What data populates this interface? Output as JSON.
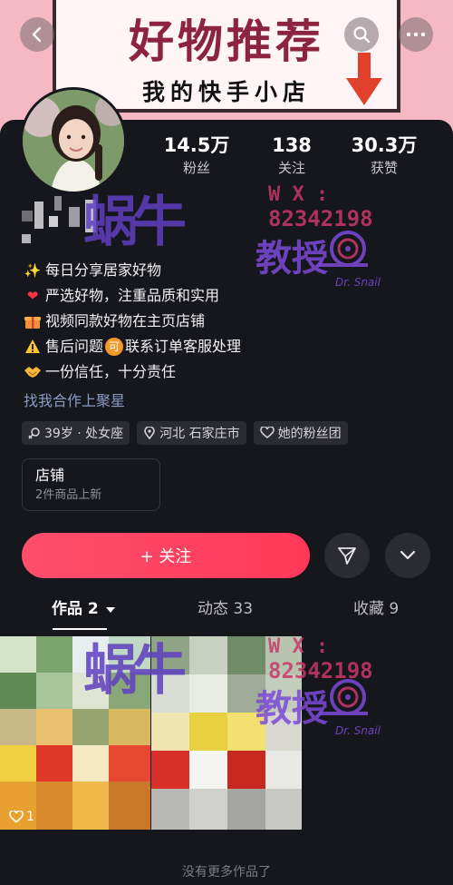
{
  "banner": {
    "title": "好物推荐",
    "subtitle": "我的快手小店"
  },
  "header": {
    "back_icon": "chevron-left-icon",
    "search_icon": "search-icon",
    "more_icon": "more-dots-icon"
  },
  "stats": [
    {
      "value": "14.5万",
      "label": "粉丝"
    },
    {
      "value": "138",
      "label": "关注"
    },
    {
      "value": "30.3万",
      "label": "获赞"
    }
  ],
  "bio": {
    "lines": [
      {
        "icon": "sparkles-icon",
        "text": "每日分享居家好物"
      },
      {
        "icon": "heart-icon",
        "text": "严选好物，注重品质和实用"
      },
      {
        "icon": "gift-icon",
        "text": "视频同款好物在主页店铺"
      },
      {
        "icon": "warning-icon",
        "text_before": "售后问题",
        "badge": "可",
        "text_after": "联系订单客服处理"
      },
      {
        "icon": "handshake-icon",
        "text": "一份信任，十分责任"
      }
    ],
    "link": "找我合作上聚星"
  },
  "tags": [
    {
      "icon": "gender-icon",
      "text": "39岁 · 处女座"
    },
    {
      "icon": "location-icon",
      "text": "河北 石家庄市"
    },
    {
      "icon": "fan-group-icon",
      "text": "她的粉丝团"
    }
  ],
  "shop": {
    "title": "店铺",
    "subtitle": "2件商品上新"
  },
  "actions": {
    "follow_label": "+ 关注",
    "share_icon": "send-icon",
    "dropdown_icon": "chevron-down-icon"
  },
  "tabs": [
    {
      "label": "作品 2",
      "active": true
    },
    {
      "label": "动态 33",
      "active": false
    },
    {
      "label": "收藏 9",
      "active": false
    }
  ],
  "works": [
    {
      "likes": "1"
    }
  ],
  "footer": {
    "end_text": "没有更多作品了"
  },
  "watermark": {
    "big_text": "蜗牛",
    "wx_label": "W X :",
    "wx_number": "82342198",
    "suffix": "教授",
    "brand": "Dr. Snail"
  },
  "colors": {
    "accent": "#ff4565",
    "background": "#16161d",
    "banner": "#f6b8c4",
    "link": "#8a9cc4"
  }
}
